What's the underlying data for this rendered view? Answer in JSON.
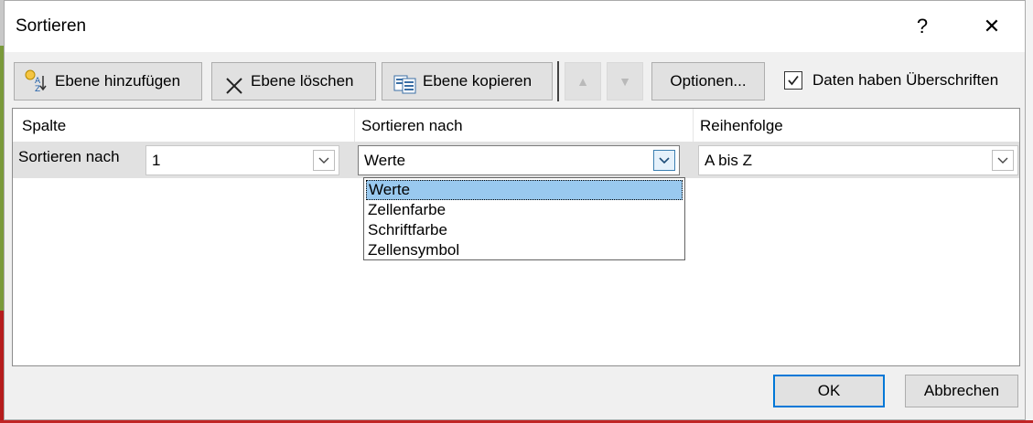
{
  "dialog": {
    "title": "Sortieren",
    "help_label": "?",
    "close_label": "✕"
  },
  "toolbar": {
    "add_level": "Ebene hinzufügen",
    "delete_level": "Ebene löschen",
    "copy_level": "Ebene kopieren",
    "move_up": "▲",
    "move_down": "▼",
    "options": "Optionen...",
    "headers_label": "Daten haben Überschriften",
    "headers_checked": true
  },
  "grid": {
    "columns": [
      "Spalte",
      "Sortieren nach",
      "Reihenfolge"
    ],
    "row": {
      "label": "Sortieren nach",
      "column_value": "1",
      "sort_on_value": "Werte",
      "order_value": "A bis Z"
    }
  },
  "dropdown": {
    "options": [
      "Werte",
      "Zellenfarbe",
      "Schriftfarbe",
      "Zellensymbol"
    ],
    "selected": "Werte"
  },
  "footer": {
    "ok": "OK",
    "cancel": "Abbrechen"
  }
}
